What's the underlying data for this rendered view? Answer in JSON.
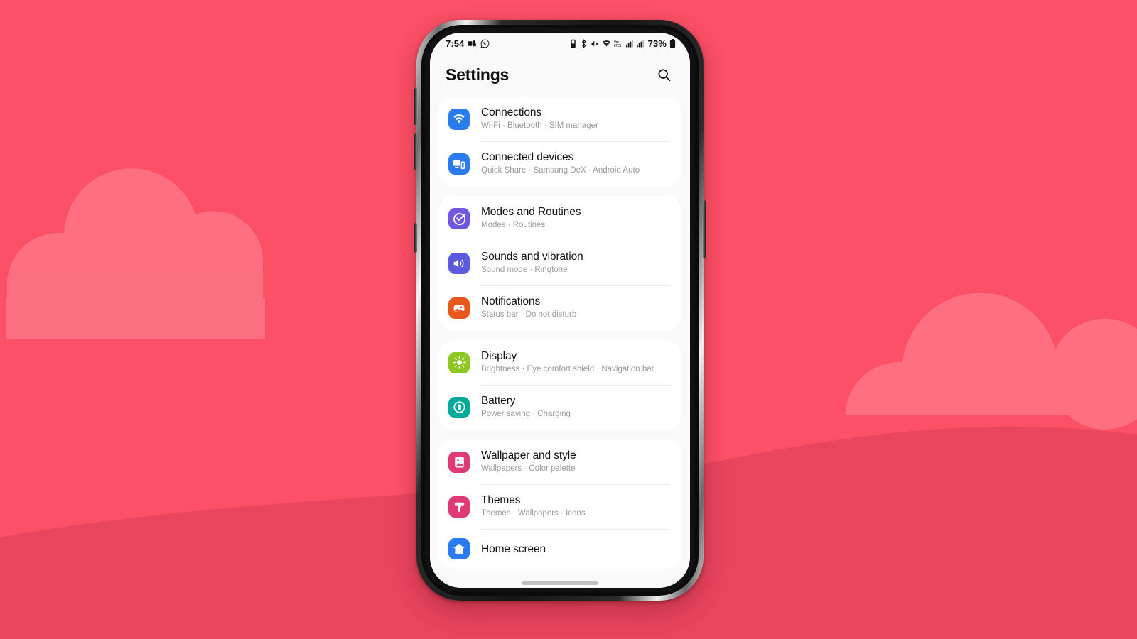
{
  "wallpaper": {
    "bg_color": "#FB5066",
    "cloud_color": "#FC6E80",
    "hill_color": "#E8455E"
  },
  "phone": {
    "buttons": [
      {
        "name": "volume-up-button"
      },
      {
        "name": "volume-down-button"
      },
      {
        "name": "bixby-button"
      },
      {
        "name": "power-button"
      }
    ]
  },
  "status_bar": {
    "time": "7:54",
    "left_icons": [
      "teams-icon",
      "whatsapp-icon"
    ],
    "right_icons": [
      "alarm-icon",
      "bluetooth-icon",
      "mute-icon",
      "wifi-icon",
      "volte-icon",
      "signal-sim1-icon",
      "signal-sim2-icon"
    ],
    "battery_percent": "73%",
    "battery_icon": "battery-icon"
  },
  "header": {
    "title": "Settings",
    "search_icon": "search-icon"
  },
  "groups": [
    {
      "items": [
        {
          "title": "Connections",
          "subtitle": "Wi-Fi  ·  Bluetooth  ·  SIM manager",
          "icon": "wifi-icon",
          "icon_color": "#2A7BEE"
        },
        {
          "title": "Connected devices",
          "subtitle": "Quick Share  ·  Samsung DeX  ·  Android Auto",
          "icon": "devices-icon",
          "icon_color": "#2A7BEE"
        }
      ]
    },
    {
      "items": [
        {
          "title": "Modes and Routines",
          "subtitle": "Modes  ·  Routines",
          "icon": "check-circle-icon",
          "icon_color": "#7158E2"
        },
        {
          "title": "Sounds and vibration",
          "subtitle": "Sound mode  ·  Ringtone",
          "icon": "speaker-icon",
          "icon_color": "#5B5BE0"
        },
        {
          "title": "Notifications",
          "subtitle": "Status bar  ·  Do not disturb",
          "icon": "bell-notification-icon",
          "icon_color": "#E8561C"
        }
      ]
    },
    {
      "items": [
        {
          "title": "Display",
          "subtitle": "Brightness  ·  Eye comfort shield  ·  Navigation bar",
          "icon": "brightness-icon",
          "icon_color": "#8CC820"
        },
        {
          "title": "Battery",
          "subtitle": "Power saving  ·  Charging",
          "icon": "battery-circle-icon",
          "icon_color": "#00A99A"
        }
      ]
    },
    {
      "items": [
        {
          "title": "Wallpaper and style",
          "subtitle": "Wallpapers  ·  Color palette",
          "icon": "image-icon",
          "icon_color": "#E03A75"
        },
        {
          "title": "Themes",
          "subtitle": "Themes  ·  Wallpapers  ·  Icons",
          "icon": "paint-roller-icon",
          "icon_color": "#E03A75"
        },
        {
          "title": "Home screen",
          "subtitle": "",
          "icon": "home-icon",
          "icon_color": "#2A7BEE"
        }
      ]
    }
  ],
  "nav": {
    "gesture_bar": "gesture-bar"
  }
}
